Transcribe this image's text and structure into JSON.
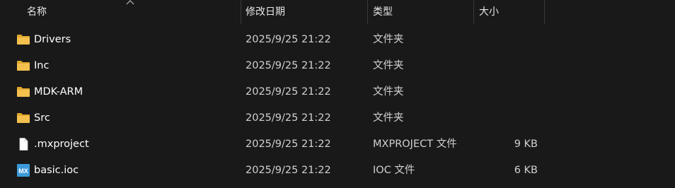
{
  "columns": {
    "name": "名称",
    "date": "修改日期",
    "type": "类型",
    "size": "大小"
  },
  "files": [
    {
      "name": "Drivers",
      "date": "2025/9/25 21:22",
      "type": "文件夹",
      "size": "",
      "icon": "folder-icon"
    },
    {
      "name": "Inc",
      "date": "2025/9/25 21:22",
      "type": "文件夹",
      "size": "",
      "icon": "folder-icon"
    },
    {
      "name": "MDK-ARM",
      "date": "2025/9/25 21:22",
      "type": "文件夹",
      "size": "",
      "icon": "folder-icon"
    },
    {
      "name": "Src",
      "date": "2025/9/25 21:22",
      "type": "文件夹",
      "size": "",
      "icon": "folder-icon"
    },
    {
      "name": ".mxproject",
      "date": "2025/9/25 21:22",
      "type": "MXPROJECT 文件",
      "size": "9 KB",
      "icon": "file-icon"
    },
    {
      "name": "basic.ioc",
      "date": "2025/9/25 21:22",
      "type": "IOC 文件",
      "size": "6 KB",
      "icon": "mx-file-icon"
    }
  ],
  "icons": {
    "mx_label": "MX"
  },
  "colors": {
    "background": "#191919",
    "folder": "#f4c04e",
    "folder_dark": "#e0a82e",
    "mx_badge": "#3b9ad9"
  }
}
